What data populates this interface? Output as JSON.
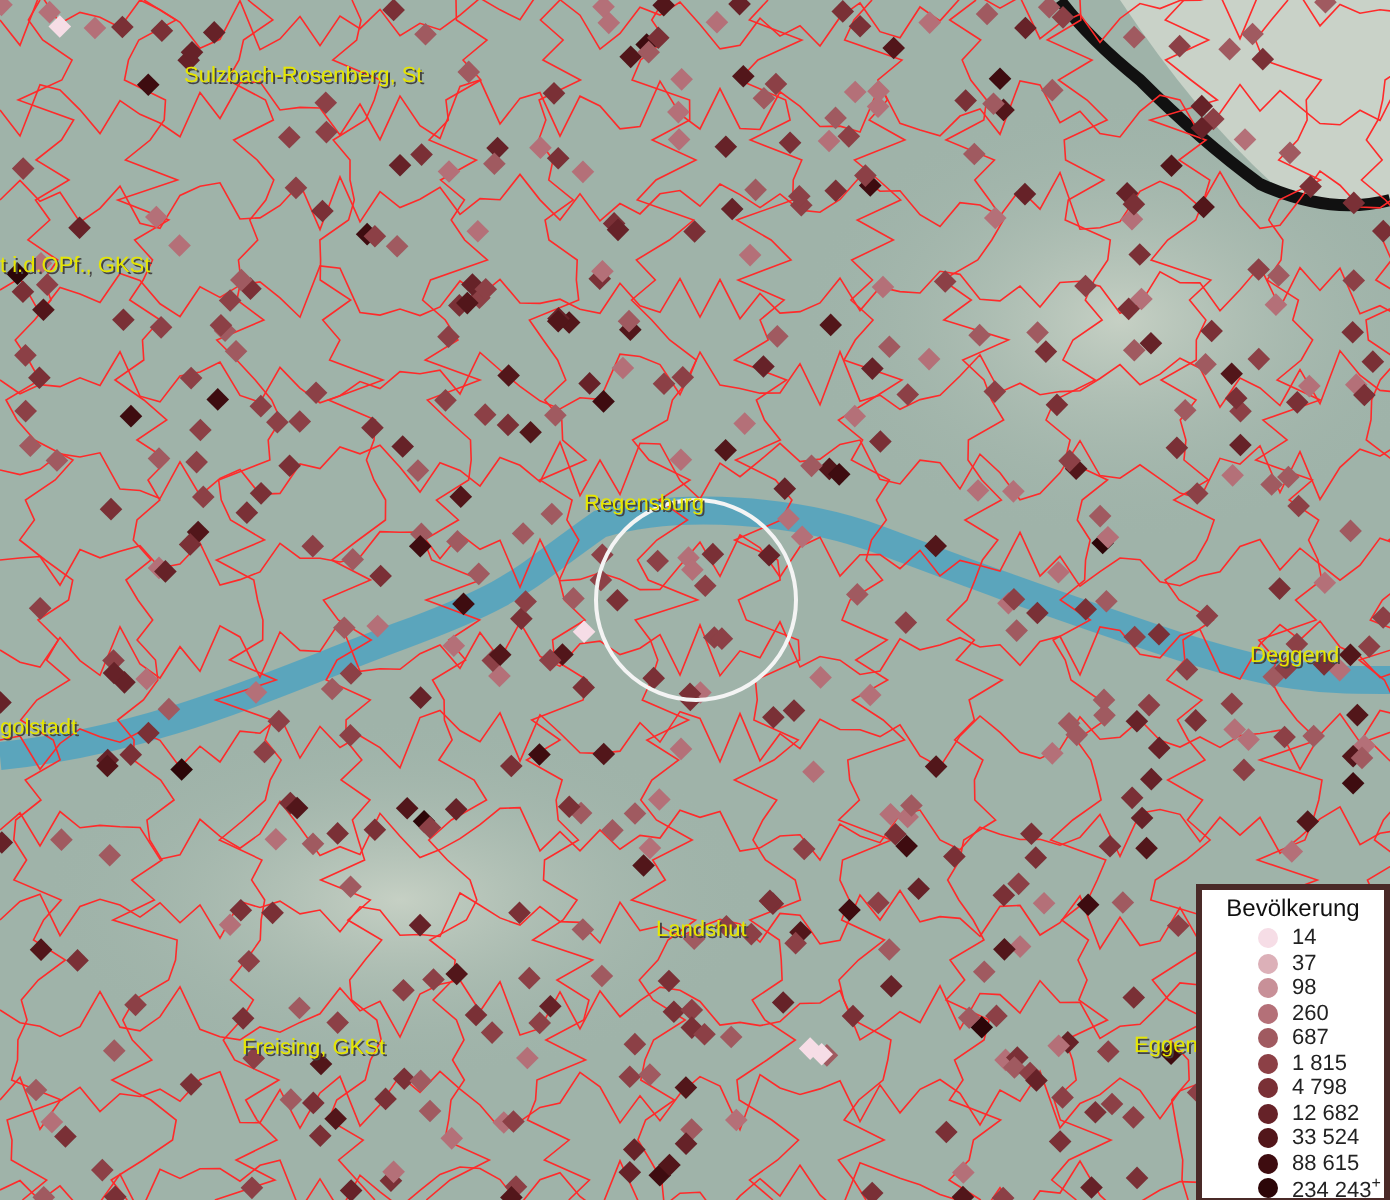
{
  "places": [
    {
      "name": "Sulzbach-Rosenberg, St"
    },
    {
      "name": "t i.d.OPf., GKSt"
    },
    {
      "name": "Regensburg"
    },
    {
      "name": "Deggend"
    },
    {
      "name": "golstadt"
    },
    {
      "name": "Landshut"
    },
    {
      "name": "Freising, GKSt"
    },
    {
      "name": "Eggen"
    }
  ],
  "legend": {
    "title": "Bevölkerung",
    "items": [
      {
        "label": "14",
        "color": "#f6dde6"
      },
      {
        "label": "37",
        "color": "#dcb0b8"
      },
      {
        "label": "98",
        "color": "#c89098"
      },
      {
        "label": "260",
        "color": "#b47078"
      },
      {
        "label": "687",
        "color": "#a05a60"
      },
      {
        "label": "1 815",
        "color": "#8c4046"
      },
      {
        "label": "4 798",
        "color": "#7a3036"
      },
      {
        "label": "12 682",
        "color": "#662228"
      },
      {
        "label": "33 524",
        "color": "#52161a"
      },
      {
        "label": "88 615",
        "color": "#3e0c10"
      },
      {
        "label": "234 243$^{+}$",
        "color": "#2c0608"
      }
    ]
  }
}
